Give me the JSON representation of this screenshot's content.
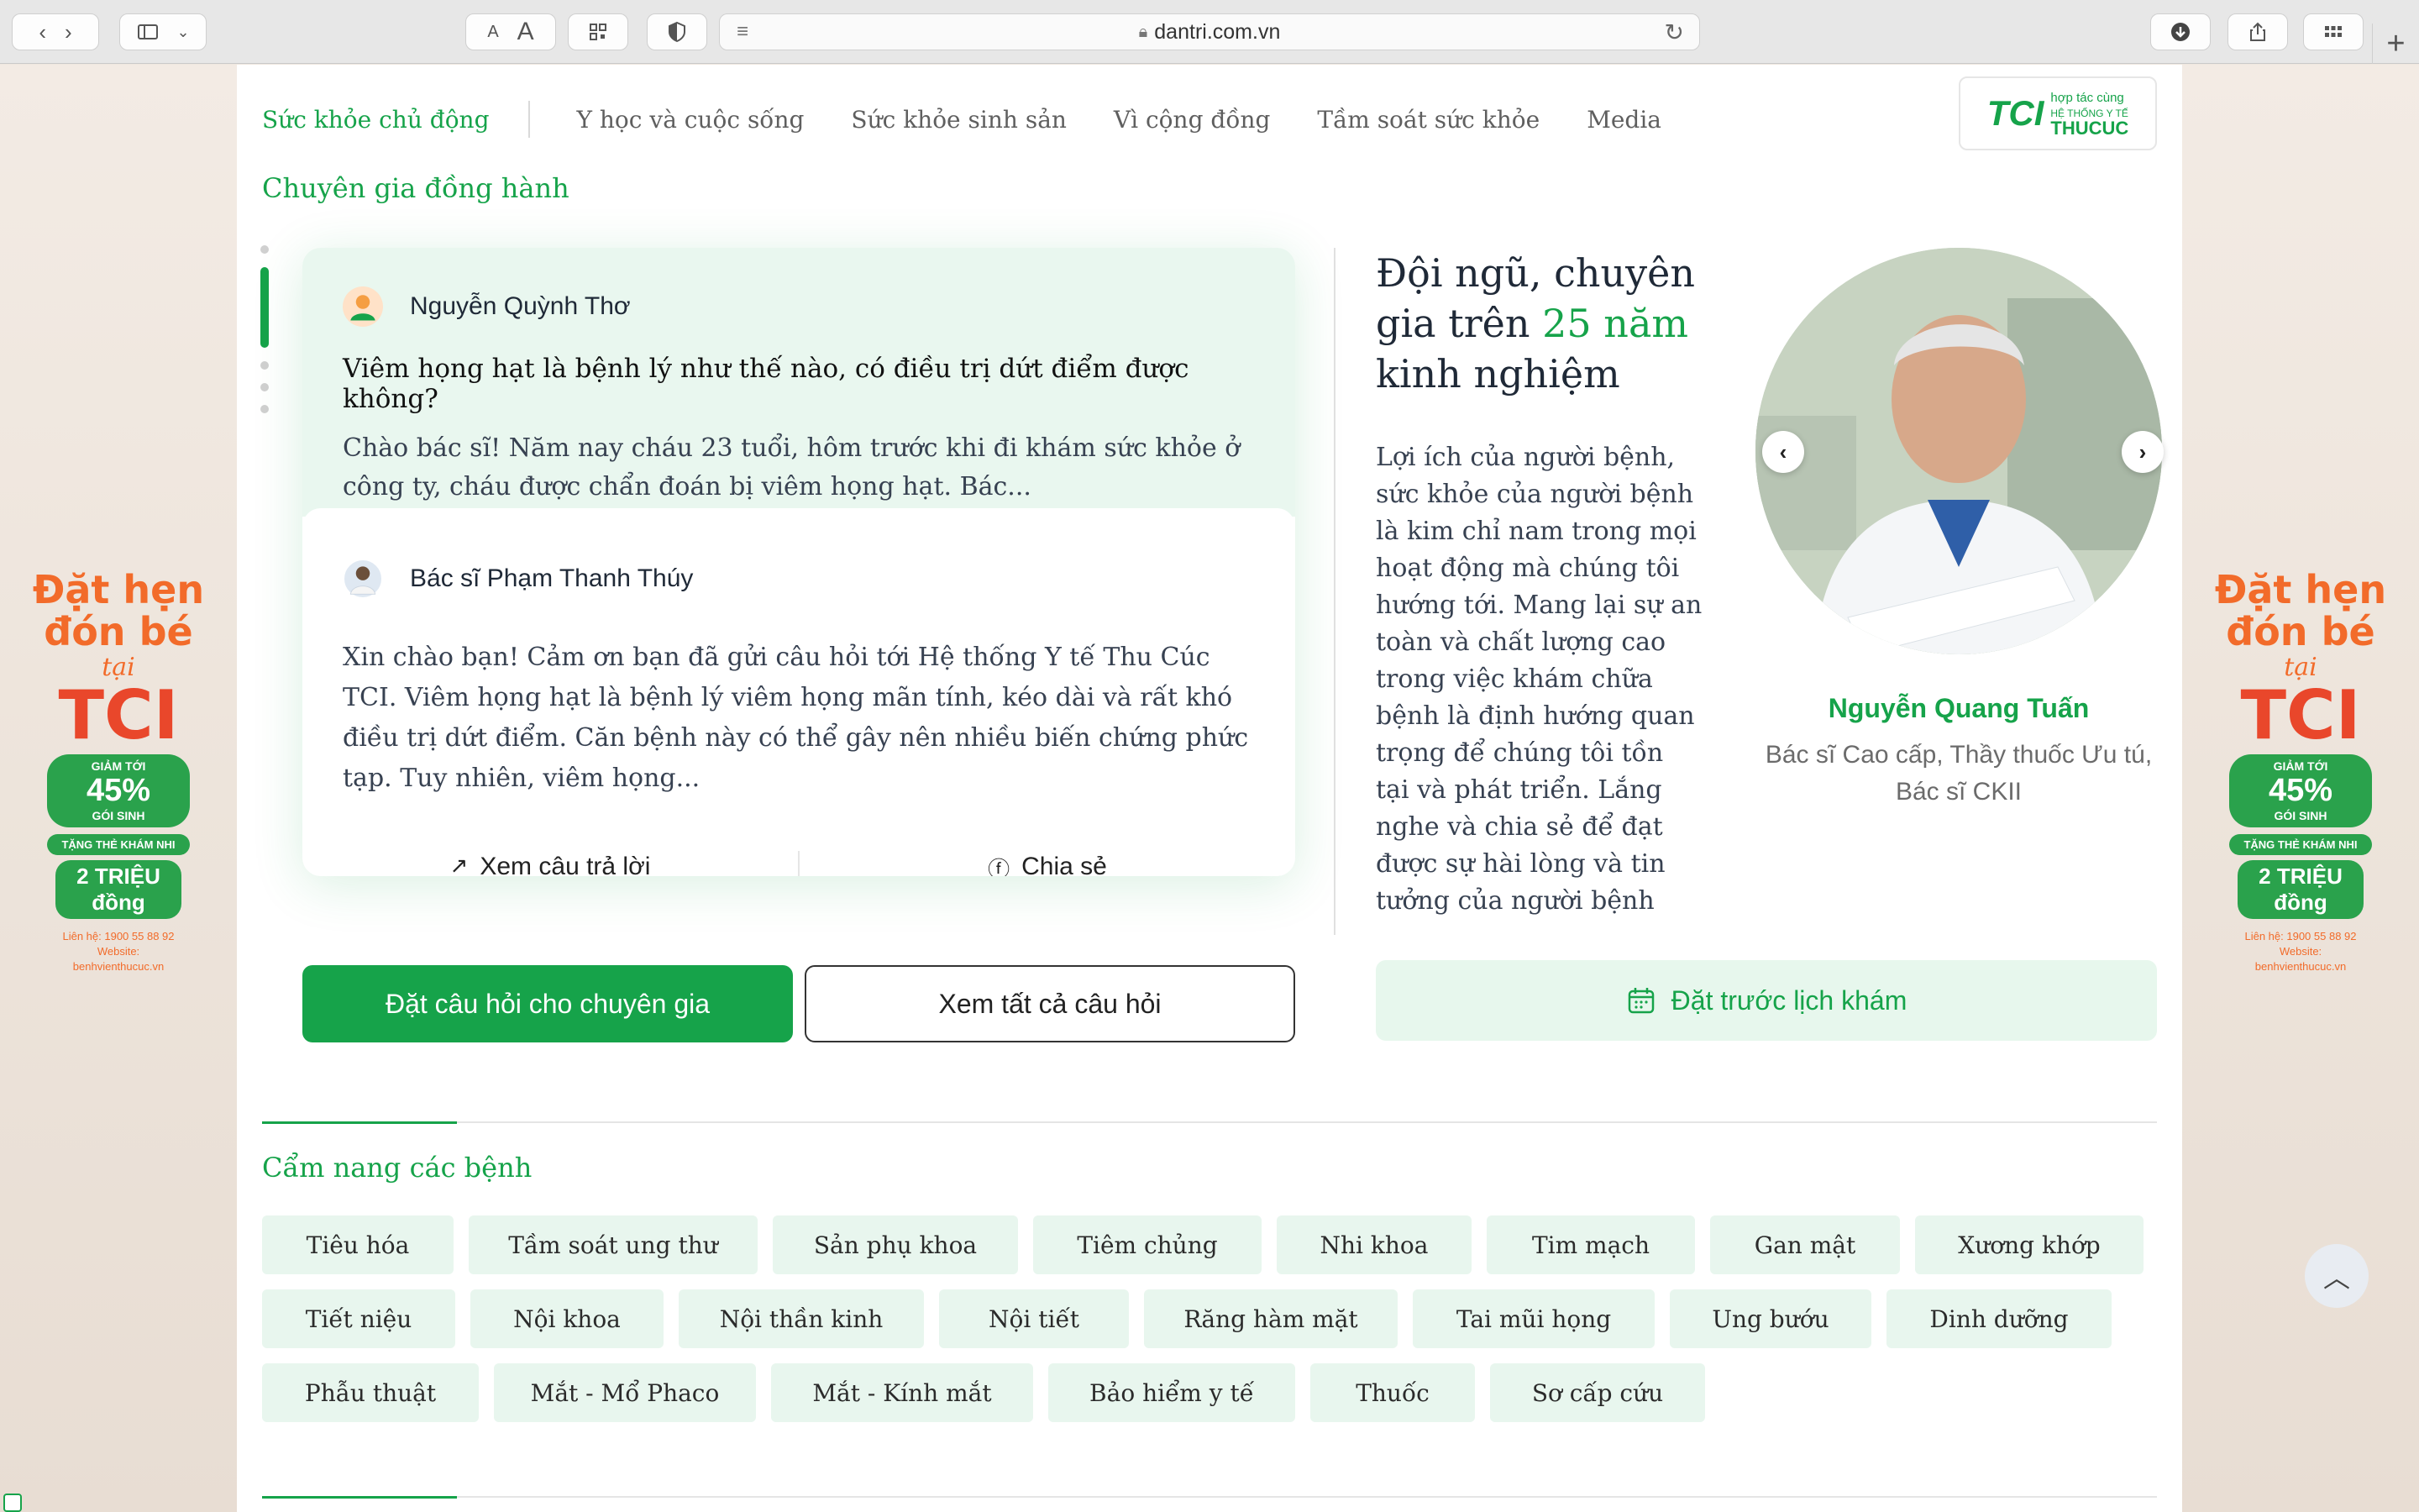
{
  "browser": {
    "url": "dantri.com.vn",
    "font_small": "A",
    "font_large": "A"
  },
  "nav": {
    "active": "Sức khỏe chủ động",
    "items": [
      "Y học và cuộc sống",
      "Sức khỏe sinh sản",
      "Vì cộng đồng",
      "Tầm soát sức khỏe",
      "Media"
    ]
  },
  "partner": {
    "line1": "hợp tác cùng",
    "line2": "HỆ THỐNG Y TẾ",
    "line3": "THUCUC",
    "mark": "TCI"
  },
  "expert": {
    "title": "Chuyên gia đồng hành",
    "asker_name": "Nguyễn Quỳnh Thơ",
    "question_title": "Viêm họng hạt là bệnh lý như thế nào, có điều trị dứt điểm được không?",
    "question_body": "Chào bác sĩ! Năm nay cháu 23 tuổi, hôm trước khi đi khám sức khỏe ở công ty, cháu được chẩn đoán bị viêm họng hạt. Bác...",
    "doctor_name": "Bác sĩ Phạm Thanh Thúy",
    "answer_body": "Xin chào bạn! Cảm ơn bạn đã gửi câu hỏi tới Hệ thống Y tế Thu Cúc TCI. Viêm họng hạt là bệnh lý viêm họng mãn tính, kéo dài và rất khó điều trị dứt điểm. Căn bệnh này có thể gây nên nhiều biến chứng phức tạp. Tuy nhiên, viêm họng...",
    "action_view": "Xem câu trả lời",
    "action_share": "Chia sẻ",
    "btn_ask": "Đặt câu hỏi cho chuyên gia",
    "btn_all": "Xem tất cả câu hỏi"
  },
  "team": {
    "title_part1": "Đội ngũ, chuyên gia trên ",
    "title_highlight": "25 năm",
    "title_part2": " kinh nghiệm",
    "desc": "Lợi ích của người bệnh, sức khỏe của người bệnh là kim chỉ nam trong mọi hoạt động mà chúng tôi hướng tới. Mang lại sự an toàn và chất lượng cao trong việc khám chữa bệnh là định hướng quan trọng để chúng tôi tồn tại và phát triển. Lắng nghe và chia sẻ để đạt được sự hài lòng và tin tưởng của người bệnh",
    "doctor_name": "Nguyễn Quang Tuấn",
    "doctor_role": "Bác sĩ Cao cấp, Thầy thuốc Ưu tú, Bác sĩ CKII",
    "btn_book": "Đặt trước lịch khám"
  },
  "handbook": {
    "title": "Cẩm nang các bệnh",
    "rows": [
      [
        "Tiêu hóa",
        "Tầm soát ung thư",
        "Sản phụ khoa",
        "Tiêm chủng",
        "Nhi khoa",
        "Tim mạch",
        "Gan mật",
        "Xương khớp"
      ],
      [
        "Tiết niệu",
        "Nội khoa",
        "Nội thần kinh",
        "Nội tiết",
        "Răng hàm mặt",
        "Tai mũi họng",
        "Ung bướu",
        "Dinh dưỡng"
      ],
      [
        "Phẫu thuật",
        "Mắt - Mổ Phaco",
        "Mắt - Kính mắt",
        "Bảo hiểm y tế",
        "Thuốc",
        "Sơ cấp cứu"
      ]
    ]
  },
  "ad": {
    "line1": "Đặt hẹn",
    "line2": "đón bé",
    "line3": "tại",
    "brand": "TCI",
    "discount_label": "GIẢM TỚI",
    "discount": "45%",
    "discount_note": "GÓI SINH",
    "gift": "TẶNG THẺ KHÁM NHI",
    "gift_value": "2 TRIỆU đồng",
    "hotline": "Liên hệ: 1900 55 88 92",
    "website_label": "Website:",
    "website": "benhvienthucuc.vn"
  },
  "colors": {
    "brand_green": "#16a34a",
    "light_green": "#e8f6ee",
    "ad_orange": "#f26b2a"
  }
}
